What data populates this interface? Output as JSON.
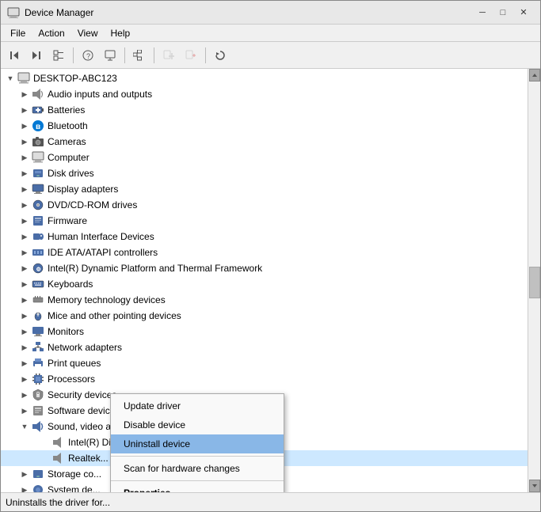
{
  "window": {
    "title": "Device Manager",
    "close_btn": "—",
    "minimize_btn": "─",
    "maximize_btn": "□"
  },
  "menu": {
    "items": [
      "File",
      "Action",
      "View",
      "Help"
    ]
  },
  "toolbar": {
    "buttons": [
      {
        "id": "back",
        "icon": "◀",
        "disabled": false
      },
      {
        "id": "forward",
        "icon": "▶",
        "disabled": false
      },
      {
        "id": "tree",
        "icon": "⊟",
        "disabled": false
      },
      {
        "id": "sep1"
      },
      {
        "id": "info",
        "icon": "❓",
        "disabled": false
      },
      {
        "id": "comp",
        "icon": "🖥",
        "disabled": false
      },
      {
        "id": "sep2"
      },
      {
        "id": "network",
        "icon": "🌐",
        "disabled": false
      },
      {
        "id": "sep3"
      },
      {
        "id": "add",
        "icon": "➕",
        "disabled": true
      },
      {
        "id": "remove",
        "icon": "✖",
        "disabled": true
      },
      {
        "id": "sep4"
      },
      {
        "id": "update",
        "icon": "↓",
        "disabled": false
      }
    ]
  },
  "tree": {
    "root": {
      "label": "DESKTOP-ABC123",
      "icon": "computer"
    },
    "items": [
      {
        "id": "audio",
        "label": "Audio inputs and outputs",
        "icon": "🔊",
        "indent": 1,
        "expanded": false
      },
      {
        "id": "batteries",
        "label": "Batteries",
        "icon": "🔋",
        "indent": 1,
        "expanded": false
      },
      {
        "id": "bluetooth",
        "label": "Bluetooth",
        "icon": "🔵",
        "indent": 1,
        "expanded": false
      },
      {
        "id": "cameras",
        "label": "Cameras",
        "icon": "📷",
        "indent": 1,
        "expanded": false
      },
      {
        "id": "computer",
        "label": "Computer",
        "icon": "💻",
        "indent": 1,
        "expanded": false
      },
      {
        "id": "diskdrives",
        "label": "Disk drives",
        "icon": "💽",
        "indent": 1,
        "expanded": false
      },
      {
        "id": "display",
        "label": "Display adapters",
        "icon": "🖥",
        "indent": 1,
        "expanded": false
      },
      {
        "id": "dvd",
        "label": "DVD/CD-ROM drives",
        "icon": "💿",
        "indent": 1,
        "expanded": false
      },
      {
        "id": "firmware",
        "label": "Firmware",
        "icon": "📦",
        "indent": 1,
        "expanded": false
      },
      {
        "id": "hid",
        "label": "Human Interface Devices",
        "icon": "🖱",
        "indent": 1,
        "expanded": false
      },
      {
        "id": "ide",
        "label": "IDE ATA/ATAPI controllers",
        "icon": "⚙",
        "indent": 1,
        "expanded": false
      },
      {
        "id": "intel",
        "label": "Intel(R) Dynamic Platform and Thermal Framework",
        "icon": "⚙",
        "indent": 1,
        "expanded": false
      },
      {
        "id": "keyboards",
        "label": "Keyboards",
        "icon": "⌨",
        "indent": 1,
        "expanded": false
      },
      {
        "id": "memory",
        "label": "Memory technology devices",
        "icon": "📋",
        "indent": 1,
        "expanded": false
      },
      {
        "id": "mice",
        "label": "Mice and other pointing devices",
        "icon": "🖱",
        "indent": 1,
        "expanded": false
      },
      {
        "id": "monitors",
        "label": "Monitors",
        "icon": "🖥",
        "indent": 1,
        "expanded": false
      },
      {
        "id": "network",
        "label": "Network adapters",
        "icon": "🌐",
        "indent": 1,
        "expanded": false
      },
      {
        "id": "print",
        "label": "Print queues",
        "icon": "🖨",
        "indent": 1,
        "expanded": false
      },
      {
        "id": "processors",
        "label": "Processors",
        "icon": "⚙",
        "indent": 1,
        "expanded": false
      },
      {
        "id": "security",
        "label": "Security devices",
        "icon": "🔒",
        "indent": 1,
        "expanded": false
      },
      {
        "id": "software",
        "label": "Software devices",
        "icon": "📦",
        "indent": 1,
        "expanded": false
      },
      {
        "id": "sound",
        "label": "Sound, video and game controllers",
        "icon": "🔊",
        "indent": 1,
        "expanded": true
      },
      {
        "id": "intel-display-audio",
        "label": "Intel(R) Display Audio",
        "icon": "🔊",
        "indent": 2,
        "expanded": false
      },
      {
        "id": "realtek",
        "label": "Realtek...",
        "icon": "🔊",
        "indent": 2,
        "expanded": false,
        "selected": true
      },
      {
        "id": "storage",
        "label": "Storage co...",
        "icon": "💽",
        "indent": 1,
        "expanded": false
      },
      {
        "id": "system",
        "label": "System de...",
        "icon": "⚙",
        "indent": 1,
        "expanded": false
      }
    ]
  },
  "context_menu": {
    "items": [
      {
        "id": "update",
        "label": "Update driver",
        "bold": false,
        "highlighted": false
      },
      {
        "id": "disable",
        "label": "Disable device",
        "bold": false,
        "highlighted": false
      },
      {
        "id": "uninstall",
        "label": "Uninstall device",
        "bold": false,
        "highlighted": true
      },
      {
        "id": "sep"
      },
      {
        "id": "scan",
        "label": "Scan for hardware changes",
        "bold": false,
        "highlighted": false
      },
      {
        "id": "sep2"
      },
      {
        "id": "properties",
        "label": "Properties",
        "bold": true,
        "highlighted": false
      }
    ]
  },
  "status_bar": {
    "text": "Uninstalls the driver for..."
  }
}
